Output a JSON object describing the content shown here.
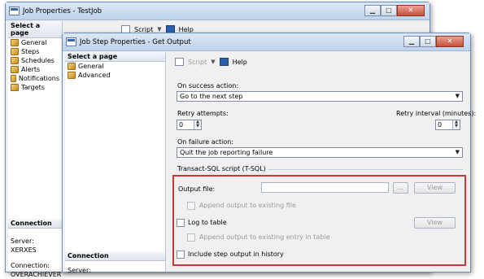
{
  "back_window": {
    "title": "Job Properties - TestJob",
    "controls": {
      "minimize": "▁",
      "maximize": "□",
      "close": "✕"
    },
    "select_page_header": "Select a page",
    "pages": [
      {
        "label": "General",
        "icon": "page-icon"
      },
      {
        "label": "Steps",
        "icon": "page-icon"
      },
      {
        "label": "Schedules",
        "icon": "page-icon"
      },
      {
        "label": "Alerts",
        "icon": "page-icon"
      },
      {
        "label": "Notifications",
        "icon": "page-icon"
      },
      {
        "label": "Targets",
        "icon": "page-icon"
      }
    ],
    "toolbar": {
      "script_label": "Script",
      "help_label": "Help"
    },
    "connection_header": "Connection",
    "server_label": "Server:",
    "server_value": "XERXES",
    "connection_label": "Connection:",
    "connection_value": "OVERACHIEVER"
  },
  "front_window": {
    "title": "Job Step Properties - Get Output",
    "controls": {
      "minimize": "▁",
      "maximize": "□",
      "close": "✕"
    },
    "select_page_header": "Select a page",
    "pages": [
      {
        "label": "General",
        "icon": "page-icon"
      },
      {
        "label": "Advanced",
        "icon": "page-icon"
      }
    ],
    "toolbar": {
      "script_label": "Script",
      "help_label": "Help"
    },
    "connection_header": "Connection",
    "server_label": "Server:",
    "on_success_label": "On success action:",
    "on_success_value": "Go to the next step",
    "retry_attempts_label": "Retry attempts:",
    "retry_attempts_value": "0",
    "retry_interval_label": "Retry interval (minutes):",
    "retry_interval_value": "0",
    "on_failure_label": "On failure action:",
    "on_failure_value": "Quit the job reporting failure",
    "tsql_group_label": "Transact-SQL script (T-SQL)",
    "output_file_label": "Output file:",
    "output_file_value": "",
    "browse_label": "...",
    "view_label": "View",
    "append_output_label": "Append output to existing file",
    "log_to_table_label": "Log to table",
    "view2_label": "View",
    "append_entry_label": "Append output to existing entry in table",
    "include_history_label": "Include step output in history"
  },
  "colors": {
    "highlight_box": "#c8383a",
    "title_bar": "#bfd3ec"
  }
}
